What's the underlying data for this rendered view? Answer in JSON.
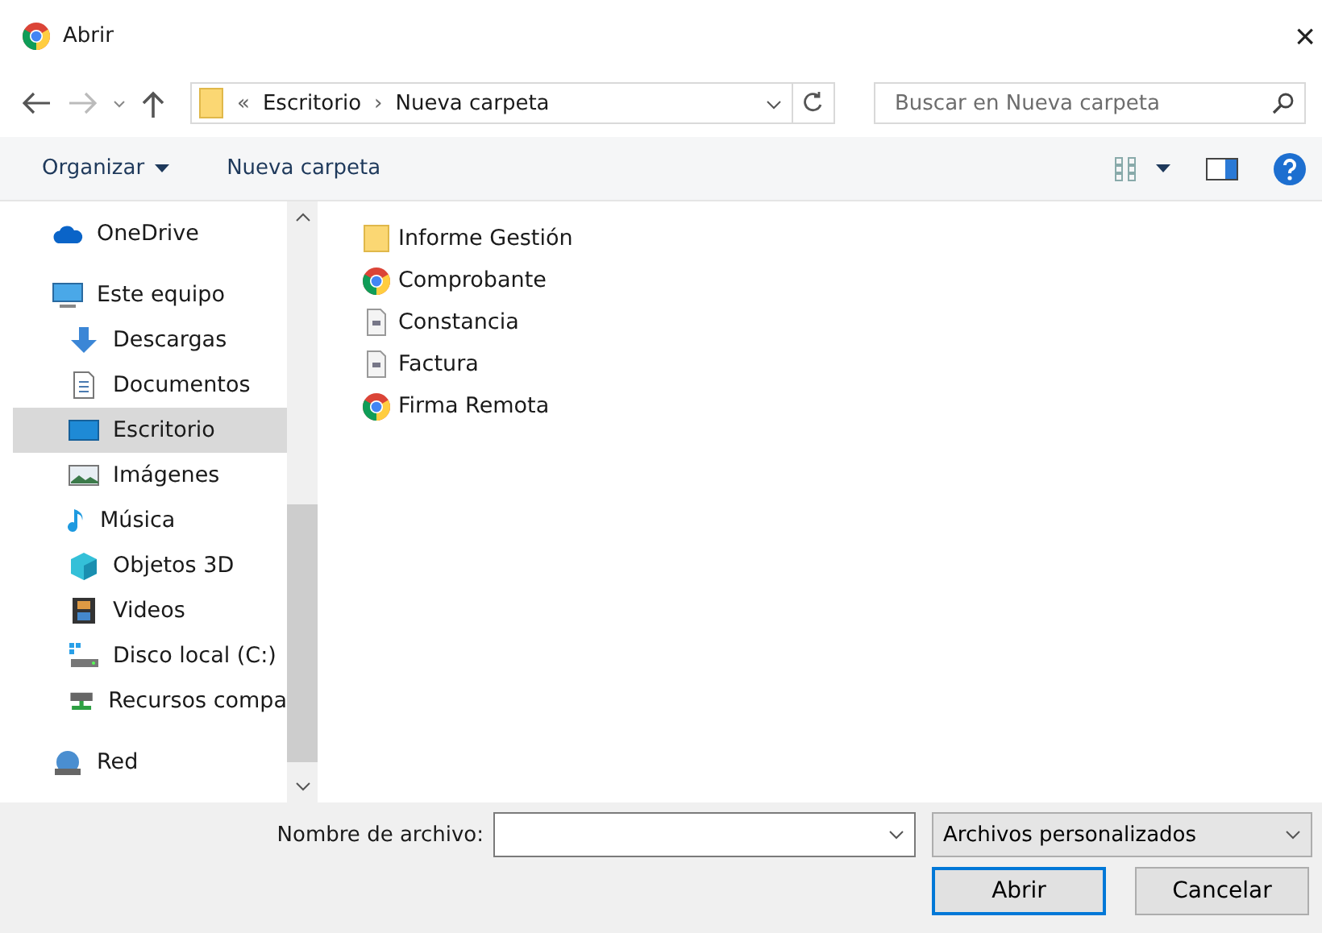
{
  "window": {
    "title": "Abrir",
    "close": "×"
  },
  "address": {
    "prefix": "«",
    "segments": [
      "Escritorio",
      "Nueva carpeta"
    ],
    "separator": "›"
  },
  "search": {
    "placeholder": "Buscar en Nueva carpeta"
  },
  "toolbar": {
    "organize": "Organizar",
    "new_folder": "Nueva carpeta"
  },
  "sidebar": {
    "items": [
      {
        "label": "OneDrive",
        "kind": "cloud",
        "selected": false
      },
      {
        "label": "Este equipo",
        "kind": "pc",
        "selected": false,
        "children": [
          {
            "label": "Descargas",
            "kind": "download",
            "selected": false
          },
          {
            "label": "Documentos",
            "kind": "document",
            "selected": false
          },
          {
            "label": "Escritorio",
            "kind": "desktop",
            "selected": true
          },
          {
            "label": "Imágenes",
            "kind": "image",
            "selected": false
          },
          {
            "label": "Música",
            "kind": "music",
            "selected": false
          },
          {
            "label": "Objetos 3D",
            "kind": "cube",
            "selected": false
          },
          {
            "label": "Videos",
            "kind": "film",
            "selected": false
          },
          {
            "label": "Disco local (C:)",
            "kind": "drive",
            "selected": false
          },
          {
            "label": "Recursos compa",
            "kind": "share",
            "selected": false
          }
        ]
      },
      {
        "label": "Red",
        "kind": "network",
        "selected": false
      }
    ]
  },
  "files": [
    {
      "name": "Informe Gestión",
      "kind": "folder"
    },
    {
      "name": "Comprobante",
      "kind": "chrome"
    },
    {
      "name": "Constancia",
      "kind": "page"
    },
    {
      "name": "Factura",
      "kind": "page"
    },
    {
      "name": "Firma Remota",
      "kind": "chrome"
    }
  ],
  "footer": {
    "filename_label": "Nombre de archivo:",
    "filter": "Archivos personalizados",
    "open": "Abrir",
    "cancel": "Cancelar"
  }
}
